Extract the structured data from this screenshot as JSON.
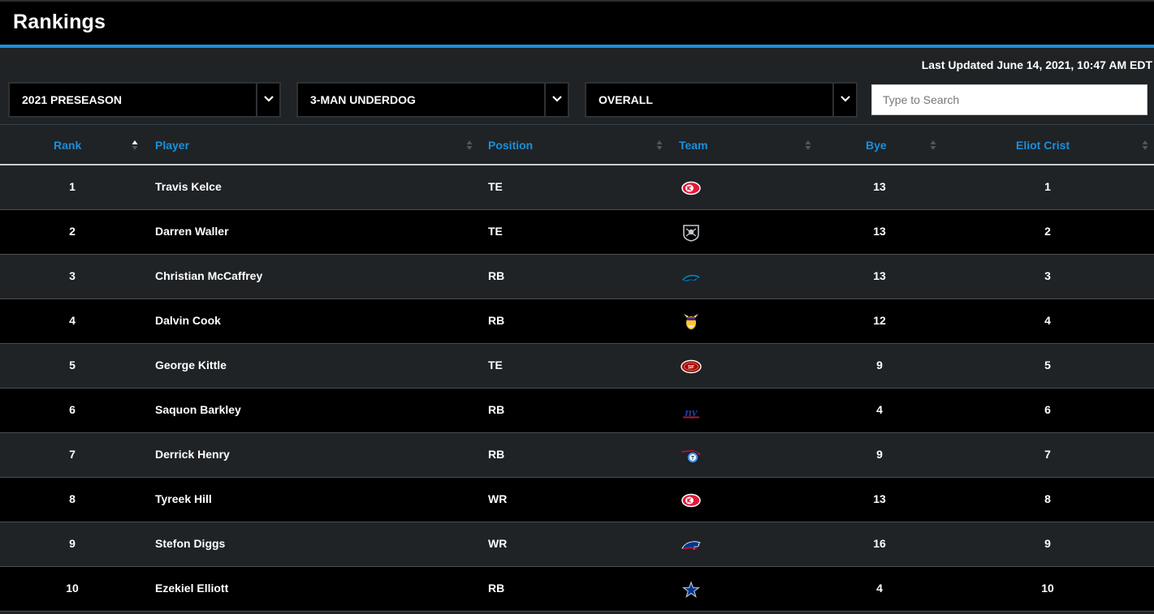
{
  "page": {
    "title": "Rankings"
  },
  "meta": {
    "last_updated": "Last Updated June 14, 2021, 10:47 AM EDT"
  },
  "filters": {
    "season": "2021 PRESEASON",
    "format": "3-MAN UNDERDOG",
    "position": "OVERALL"
  },
  "search": {
    "placeholder": "Type to Search",
    "value": ""
  },
  "colors": {
    "accent": "#1b8fd9",
    "header_bg": "#000000",
    "row_alt": "#1f2326"
  },
  "table": {
    "columns": [
      "Rank",
      "Player",
      "Position",
      "Team",
      "Bye",
      "Eliot Crist"
    ],
    "rows": [
      {
        "rank": "1",
        "player": "Travis Kelce",
        "position": "TE",
        "team_icon": "chiefs-logo-icon",
        "bye": "13",
        "eliot_crist": "1"
      },
      {
        "rank": "2",
        "player": "Darren Waller",
        "position": "TE",
        "team_icon": "raiders-logo-icon",
        "bye": "13",
        "eliot_crist": "2"
      },
      {
        "rank": "3",
        "player": "Christian McCaffrey",
        "position": "RB",
        "team_icon": "panthers-logo-icon",
        "bye": "13",
        "eliot_crist": "3"
      },
      {
        "rank": "4",
        "player": "Dalvin Cook",
        "position": "RB",
        "team_icon": "vikings-logo-icon",
        "bye": "12",
        "eliot_crist": "4"
      },
      {
        "rank": "5",
        "player": "George Kittle",
        "position": "TE",
        "team_icon": "49ers-logo-icon",
        "bye": "9",
        "eliot_crist": "5"
      },
      {
        "rank": "6",
        "player": "Saquon Barkley",
        "position": "RB",
        "team_icon": "giants-logo-icon",
        "bye": "4",
        "eliot_crist": "6"
      },
      {
        "rank": "7",
        "player": "Derrick Henry",
        "position": "RB",
        "team_icon": "titans-logo-icon",
        "bye": "9",
        "eliot_crist": "7"
      },
      {
        "rank": "8",
        "player": "Tyreek Hill",
        "position": "WR",
        "team_icon": "chiefs-logo-icon",
        "bye": "13",
        "eliot_crist": "8"
      },
      {
        "rank": "9",
        "player": "Stefon Diggs",
        "position": "WR",
        "team_icon": "bills-logo-icon",
        "bye": "16",
        "eliot_crist": "9"
      },
      {
        "rank": "10",
        "player": "Ezekiel Elliott",
        "position": "RB",
        "team_icon": "cowboys-logo-icon",
        "bye": "4",
        "eliot_crist": "10"
      }
    ]
  }
}
